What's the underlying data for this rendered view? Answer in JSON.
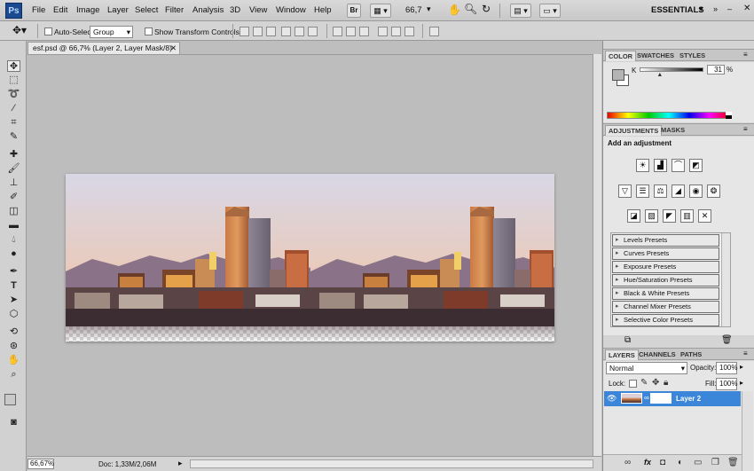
{
  "app": {
    "logo": "Ps",
    "menus": [
      "File",
      "Edit",
      "Image",
      "Layer",
      "Select",
      "Filter",
      "Analysis",
      "3D",
      "View",
      "Window",
      "Help"
    ],
    "toolbar": {
      "br_label": "Br",
      "zoom": "66,7",
      "workspace": "ESSENTIALS"
    }
  },
  "options": {
    "auto_select_label": "Auto-Select:",
    "auto_select_value": "Group",
    "transform_label": "Show Transform Controls"
  },
  "document": {
    "tab_title": "esf.psd @ 66,7% (Layer 2, Layer Mask/8)",
    "status_zoom": "66,67%",
    "status_doc": "Doc: 1,33M/2,06M"
  },
  "color_panel": {
    "tabs": [
      "COLOR",
      "SWATCHES",
      "STYLES"
    ],
    "channel_label": "K",
    "channel_value": "31",
    "unit": "%",
    "slider_level": 0.31
  },
  "adjustments_panel": {
    "tabs": [
      "ADJUSTMENTS",
      "MASKS"
    ],
    "heading": "Add an adjustment",
    "presets": [
      "Levels Presets",
      "Curves Presets",
      "Exposure Presets",
      "Hue/Saturation Presets",
      "Black & White Presets",
      "Channel Mixer Presets",
      "Selective Color Presets"
    ]
  },
  "layers_panel": {
    "tabs": [
      "LAYERS",
      "CHANNELS",
      "PATHS"
    ],
    "blend_mode": "Normal",
    "opacity_label": "Opacity:",
    "opacity_value": "100%",
    "lock_label": "Lock:",
    "fill_label": "Fill:",
    "fill_value": "100%",
    "layers": [
      {
        "name": "Layer 2"
      }
    ],
    "fx_label": "fx"
  },
  "colors": {
    "accent": "#3d8bd6",
    "layer_selected": "#3b86d8",
    "ps_blue": "#1b4a8f"
  }
}
